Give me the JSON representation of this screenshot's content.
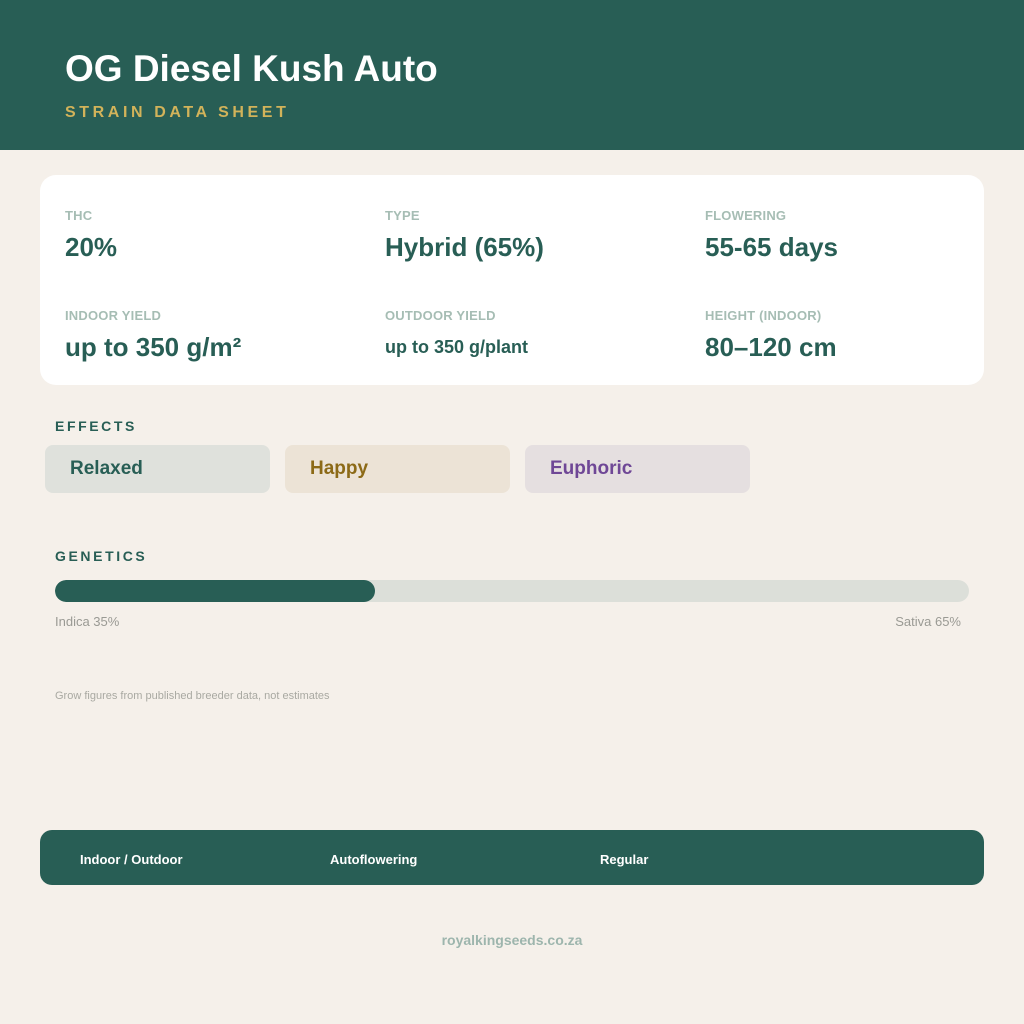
{
  "header": {
    "title": "OG Diesel Kush Auto",
    "subtitle": "STRAIN DATA SHEET"
  },
  "stats": {
    "thc": {
      "label": "THC",
      "value": "20%"
    },
    "type": {
      "label": "TYPE",
      "value": "Hybrid (65%)"
    },
    "flowering": {
      "label": "FLOWERING",
      "value": "55-65 days"
    },
    "indoor_yield": {
      "label": "INDOOR YIELD",
      "value": "up to 350 g/m²"
    },
    "outdoor_yield": {
      "label": "OUTDOOR YIELD",
      "value": "up to 350 g/plant"
    },
    "height": {
      "label": "HEIGHT (INDOOR)",
      "value": "80–120 cm"
    }
  },
  "effects": {
    "label": "EFFECTS",
    "items": [
      "Relaxed",
      "Happy",
      "Euphoric"
    ]
  },
  "genetics": {
    "label": "GENETICS",
    "indica_percent": 35,
    "sativa_percent": 65,
    "indica_label": "Indica 35%",
    "sativa_label": "Sativa 65%"
  },
  "note": "Grow figures from published breeder data, not estimates",
  "tags": [
    "Indoor / Outdoor",
    "Autoflowering",
    "Regular"
  ],
  "website": "royalkingseeds.co.za",
  "colors": {
    "primary": "#285e55",
    "accent_gold": "#d2b35a",
    "background": "#f5f0ea",
    "happy": "#8c6a17",
    "euphoric": "#6f4796"
  }
}
